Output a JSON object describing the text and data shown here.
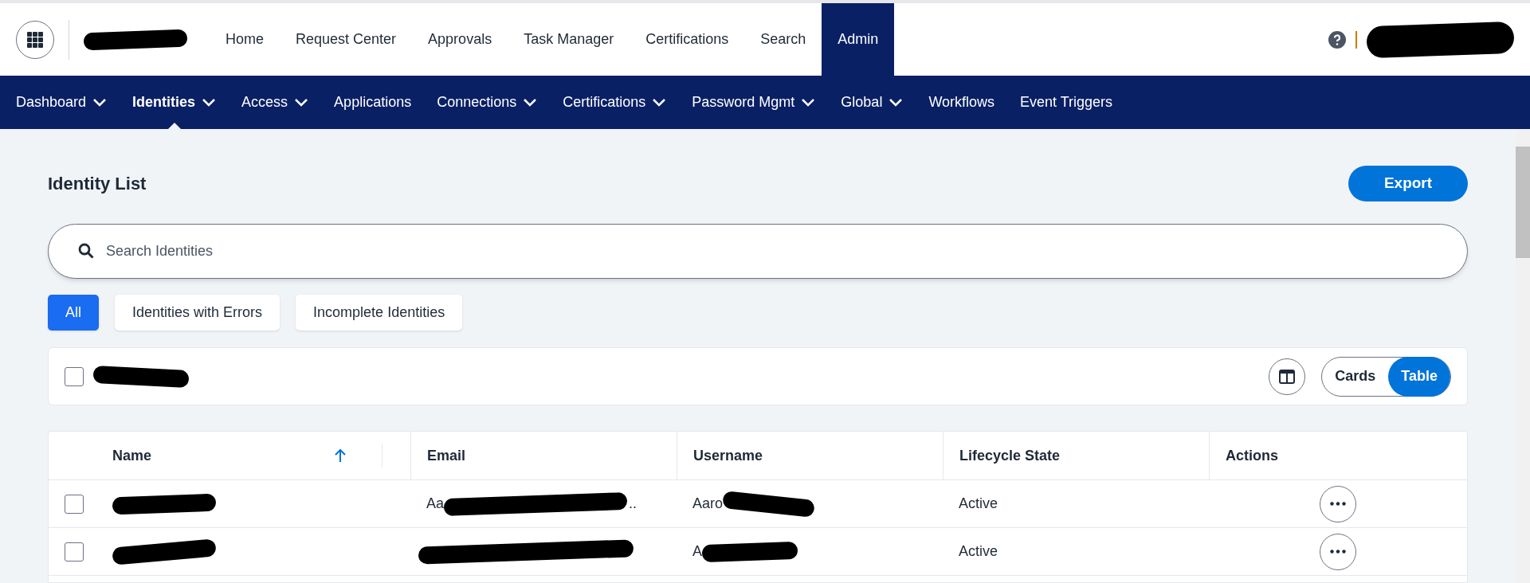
{
  "top_nav": {
    "items": [
      {
        "label": "Home",
        "selected": false
      },
      {
        "label": "Request Center",
        "selected": false
      },
      {
        "label": "Approvals",
        "selected": false
      },
      {
        "label": "Task Manager",
        "selected": false
      },
      {
        "label": "Certifications",
        "selected": false
      },
      {
        "label": "Search",
        "selected": false
      },
      {
        "label": "Admin",
        "selected": true
      }
    ]
  },
  "admin_nav": {
    "items": [
      {
        "label": "Dashboard",
        "dropdown": true,
        "selected": false
      },
      {
        "label": "Identities",
        "dropdown": true,
        "selected": true
      },
      {
        "label": "Access",
        "dropdown": true,
        "selected": false
      },
      {
        "label": "Applications",
        "dropdown": false,
        "selected": false
      },
      {
        "label": "Connections",
        "dropdown": true,
        "selected": false
      },
      {
        "label": "Certifications",
        "dropdown": true,
        "selected": false
      },
      {
        "label": "Password Mgmt",
        "dropdown": true,
        "selected": false
      },
      {
        "label": "Global",
        "dropdown": true,
        "selected": false
      },
      {
        "label": "Workflows",
        "dropdown": false,
        "selected": false
      },
      {
        "label": "Event Triggers",
        "dropdown": false,
        "selected": false
      }
    ]
  },
  "page": {
    "title": "Identity List",
    "export_button": "Export"
  },
  "search": {
    "placeholder": "Search Identities"
  },
  "filters": [
    {
      "label": "All",
      "selected": true
    },
    {
      "label": "Identities with Errors",
      "selected": false
    },
    {
      "label": "Incomplete Identities",
      "selected": false
    }
  ],
  "toolbar": {
    "select_all_checked": false,
    "view_toggle": [
      {
        "label": "Cards",
        "selected": false
      },
      {
        "label": "Table",
        "selected": true
      }
    ]
  },
  "table": {
    "columns": [
      "Name",
      "Email",
      "Username",
      "Lifecycle State",
      "Actions"
    ],
    "rows": [
      {
        "checked": false,
        "email": "Aa",
        "email_suffix": "..",
        "username": "Aaro",
        "lifecycle_state": "Active"
      },
      {
        "checked": false,
        "email": "",
        "email_suffix": "",
        "username": "A",
        "lifecycle_state": "Active"
      }
    ]
  }
}
